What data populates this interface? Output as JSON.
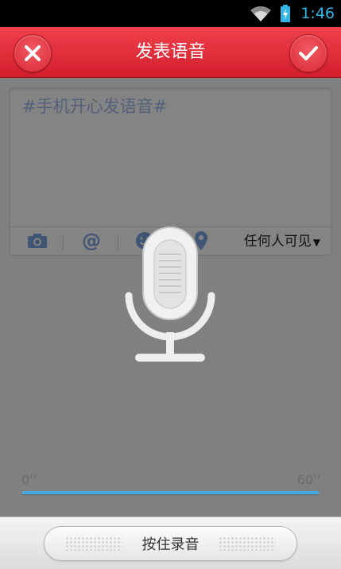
{
  "status_bar": {
    "time": "1:46",
    "icons": [
      "wifi-icon",
      "battery-charging-icon"
    ]
  },
  "header": {
    "title": "发表语音",
    "cancel_icon": "close-icon",
    "confirm_icon": "check-icon",
    "color": "#e2303c"
  },
  "compose": {
    "text": "#手机开心发语音#",
    "toolbar": {
      "icons": [
        "camera-icon",
        "at-icon",
        "emoji-icon",
        "location-icon"
      ],
      "visibility_label": "任何人可见",
      "visibility_arrow": "▼"
    }
  },
  "recorder": {
    "icon": "microphone-icon",
    "time_start": "0''",
    "time_end": "60''",
    "progress": 1.0,
    "progress_color": "#3fa9e0"
  },
  "bottom": {
    "record_button_label": "按住录音"
  }
}
